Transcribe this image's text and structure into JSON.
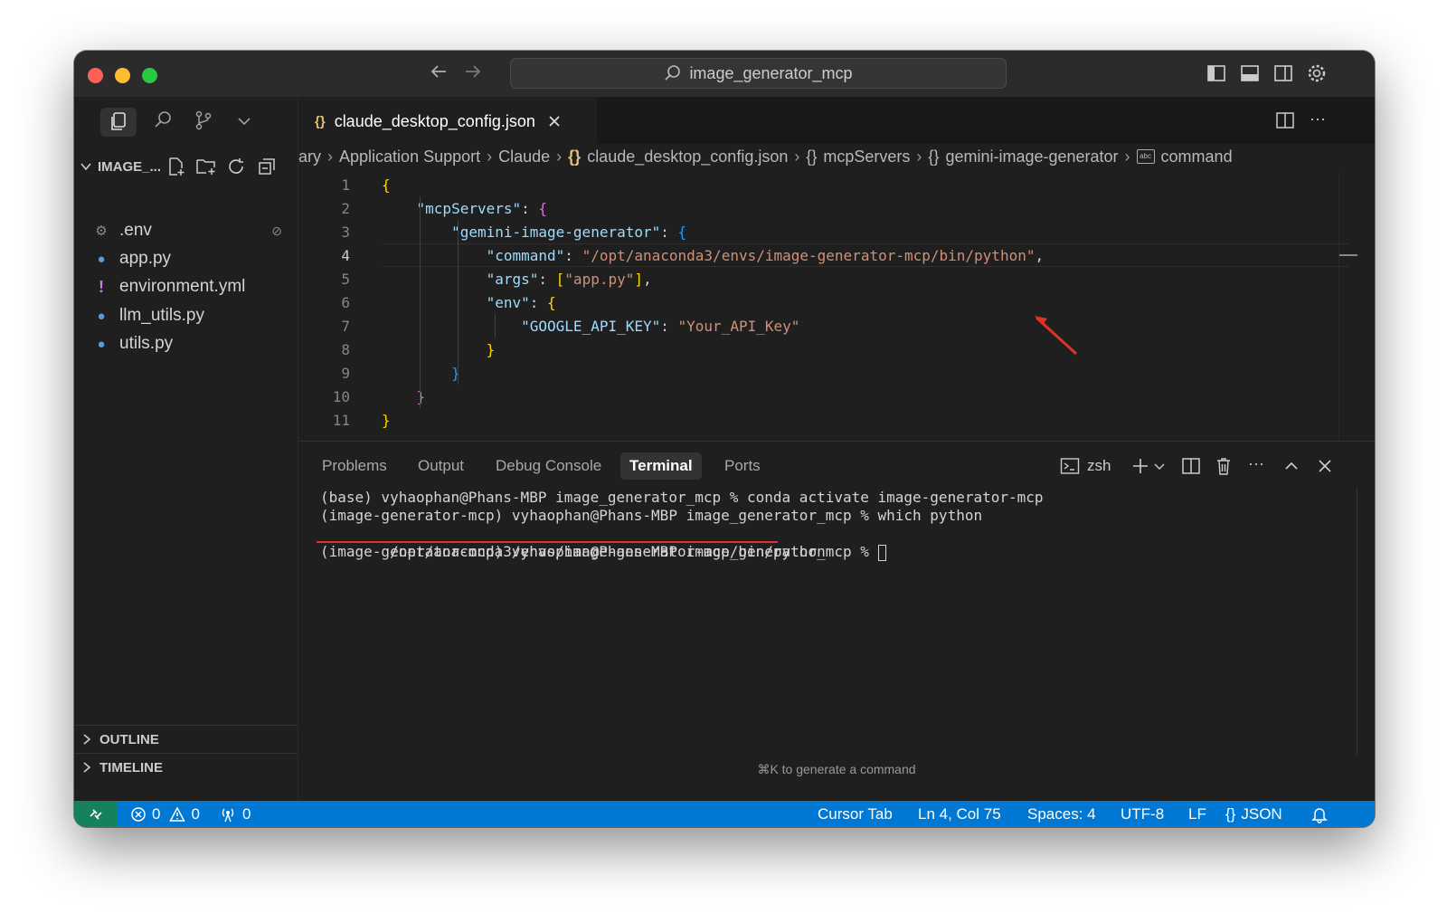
{
  "titlebar": {
    "search_text": "image_generator_mcp"
  },
  "explorer": {
    "folder_label": "IMAGE_...",
    "files": [
      {
        "name": ".env",
        "icon": "gear-icon"
      },
      {
        "name": "app.py",
        "icon": "python-icon"
      },
      {
        "name": "environment.yml",
        "icon": "exclamation-icon"
      },
      {
        "name": "llm_utils.py",
        "icon": "python-icon"
      },
      {
        "name": "utils.py",
        "icon": "python-icon"
      }
    ],
    "outline_label": "OUTLINE",
    "timeline_label": "TIMELINE"
  },
  "editor": {
    "tab_label": "claude_desktop_config.json",
    "tab_icon_text": "{}",
    "breadcrumbs": [
      "ary",
      "Application Support",
      "Claude",
      "claude_desktop_config.json",
      "mcpServers",
      "gemini-image-generator",
      "command"
    ],
    "line_numbers": [
      "1",
      "2",
      "3",
      "4",
      "5",
      "6",
      "7",
      "8",
      "9",
      "10",
      "11"
    ],
    "code": {
      "mcp_key": "\"mcpServers\"",
      "gig_key": "\"gemini-image-generator\"",
      "command_key": "\"command\"",
      "command_val": "\"/opt/anaconda3/envs/image-generator-mcp/bin/python\"",
      "args_key": "\"args\"",
      "args_val": "\"app.py\"",
      "env_key": "\"env\"",
      "api_key": "\"GOOGLE_API_KEY\"",
      "api_val": "\"Your_API_Key\""
    }
  },
  "panel": {
    "tabs": [
      "Problems",
      "Output",
      "Debug Console",
      "Terminal",
      "Ports"
    ],
    "shell_label": "zsh",
    "terminal_lines": [
      "(base) vyhaophan@Phans-MBP image_generator_mcp % conda activate image-generator-mcp",
      "(image-generator-mcp) vyhaophan@Phans-MBP image_generator_mcp % which python",
      "/opt/anaconda3/envs/image-generator-mcp/bin/python",
      "(image-generator-mcp) vyhaophan@Phans-MBP image_generator_mcp % "
    ],
    "hint": "⌘K to generate a command"
  },
  "statusbar": {
    "errors": "0",
    "warnings": "0",
    "ports": "0",
    "cursor_tab": "Cursor Tab",
    "position": "Ln 4, Col 75",
    "spaces": "Spaces: 4",
    "encoding": "UTF-8",
    "eol": "LF",
    "language": "JSON"
  },
  "colors": {
    "statusbar": "#0078d4",
    "annotation": "#e0312b"
  }
}
